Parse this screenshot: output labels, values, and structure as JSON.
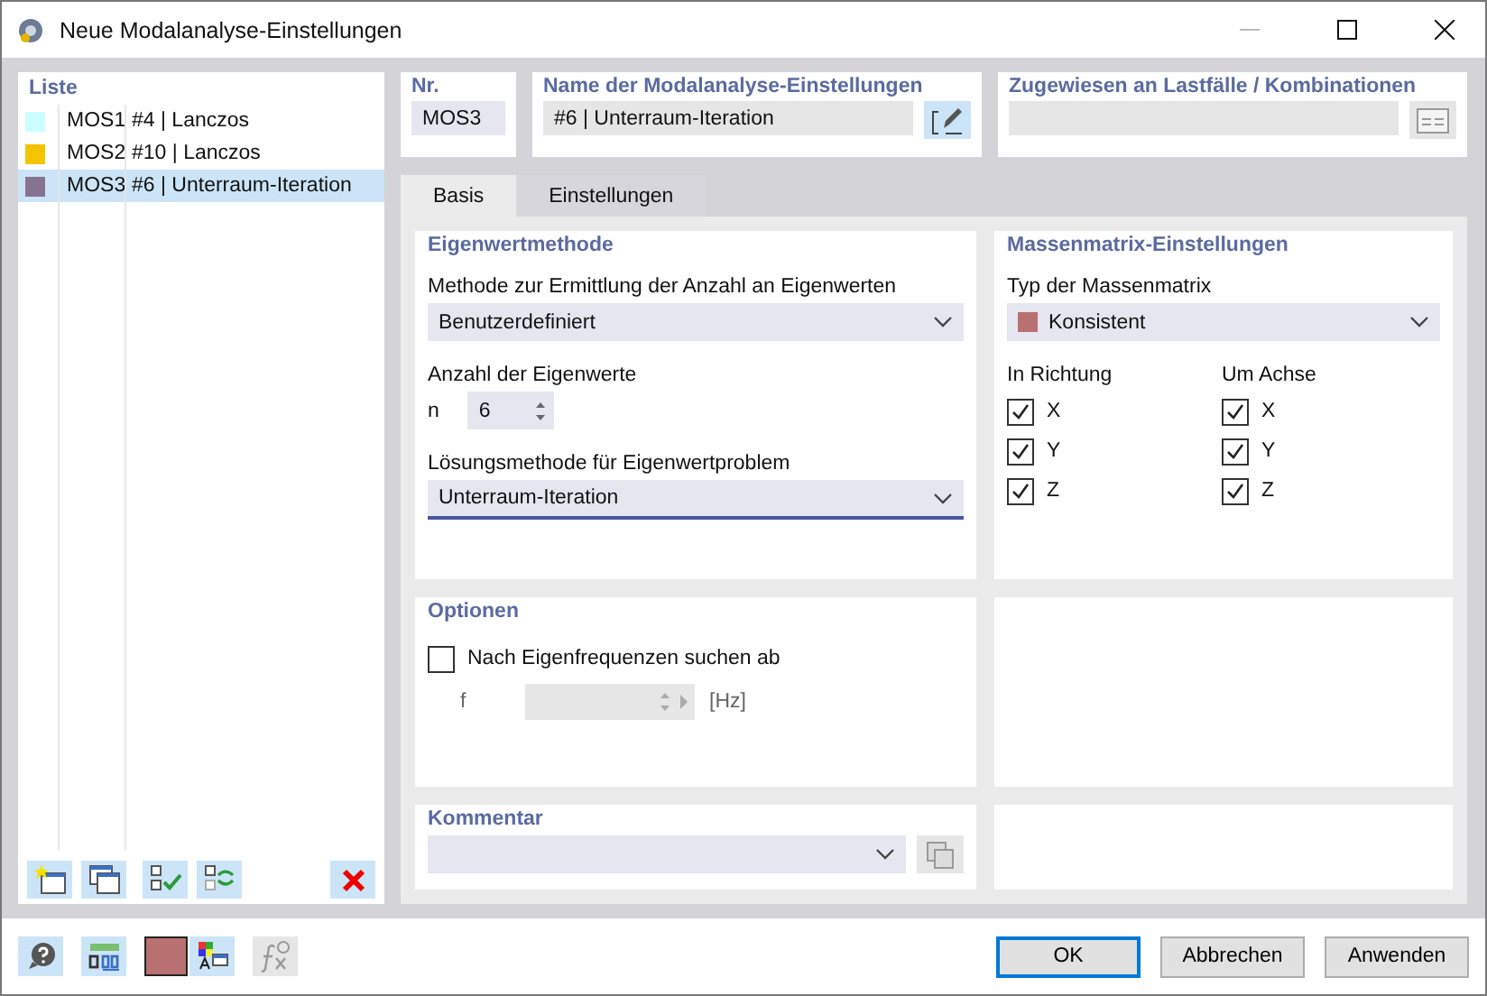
{
  "window": {
    "title": "Neue Modalanalyse-Einstellungen"
  },
  "list": {
    "title": "Liste",
    "items": [
      {
        "code": "MOS1",
        "name": "#4 | Lanczos",
        "color": "#ccffff",
        "selected": false
      },
      {
        "code": "MOS2",
        "name": "#10 | Lanczos",
        "color": "#f5c400",
        "selected": false
      },
      {
        "code": "MOS3",
        "name": "#6 | Unterraum-Iteration",
        "color": "#86738f",
        "selected": true
      }
    ]
  },
  "number": {
    "label": "Nr.",
    "value": "MOS3"
  },
  "name": {
    "label": "Name der Modalanalyse-Einstellungen",
    "value": "#6 | Unterraum-Iteration"
  },
  "assigned": {
    "label": "Zugewiesen an Lastfälle / Kombinationen"
  },
  "tabs": [
    {
      "label": "Basis",
      "selected": true
    },
    {
      "label": "Einstellungen",
      "selected": false
    }
  ],
  "eigen": {
    "title": "Eigenwertmethode",
    "method_label": "Methode zur Ermittlung der Anzahl an Eigenwerten",
    "method_value": "Benutzerdefiniert",
    "count_label": "Anzahl der Eigenwerte",
    "count_symbol": "n",
    "count_value": "6",
    "solver_label": "Lösungsmethode für Eigenwertproblem",
    "solver_value": "Unterraum-Iteration"
  },
  "mass": {
    "title": "Massenmatrix-Einstellungen",
    "type_label": "Typ der Massenmatrix",
    "type_value": "Konsistent",
    "direction_label": "In Richtung",
    "axis_label": "Um Achse",
    "directions": [
      {
        "label": "X",
        "checked": true
      },
      {
        "label": "Y",
        "checked": true
      },
      {
        "label": "Z",
        "checked": true
      }
    ],
    "axes": [
      {
        "label": "X",
        "checked": true
      },
      {
        "label": "Y",
        "checked": true
      },
      {
        "label": "Z",
        "checked": true
      }
    ]
  },
  "options": {
    "title": "Optionen",
    "search": {
      "label": "Nach Eigenfrequenzen suchen ab",
      "checked": false
    },
    "freq": {
      "symbol": "f",
      "unit": "[Hz]",
      "disabled": true
    }
  },
  "comment": {
    "title": "Kommentar"
  },
  "buttons": [
    {
      "label": "OK",
      "default": true
    },
    {
      "label": "Abbrechen",
      "default": false
    },
    {
      "label": "Anwenden",
      "default": false
    }
  ]
}
